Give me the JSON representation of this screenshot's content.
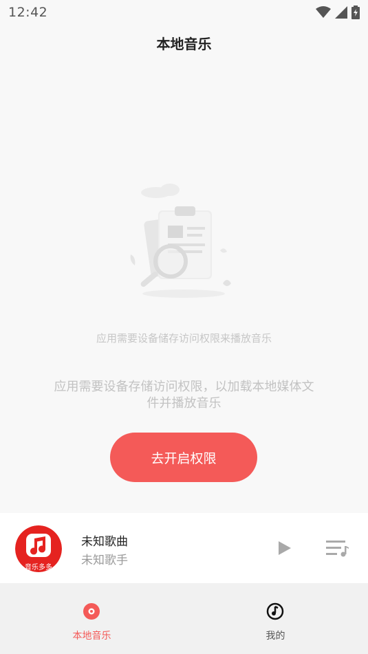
{
  "status_bar": {
    "time": "12:42",
    "icons": [
      "wifi-icon",
      "signal-icon",
      "battery-charging-icon"
    ]
  },
  "header": {
    "title": "本地音乐"
  },
  "empty_state": {
    "illustration": "clipboard-search-illustration",
    "hint_small": "应用需要设备储存访问权限来播放音乐",
    "hint_main": "应用需要设备存储访问权限，以加载本地媒体文件并播放音乐",
    "button_label": "去开启权限"
  },
  "mini_player": {
    "album_art": "music-note-logo",
    "album_art_text": "音乐多多",
    "song_title": "未知歌曲",
    "artist": "未知歌手",
    "play_icon": "play-icon",
    "playlist_icon": "playlist-icon"
  },
  "bottom_nav": {
    "items": [
      {
        "label": "本地音乐",
        "icon": "disc-icon",
        "active": true
      },
      {
        "label": "我的",
        "icon": "music-note-circle-icon",
        "active": false
      }
    ],
    "active_color": "#f45a58",
    "inactive_color": "#555555"
  },
  "colors": {
    "accent": "#f45a58",
    "background": "#f8f8f8"
  }
}
